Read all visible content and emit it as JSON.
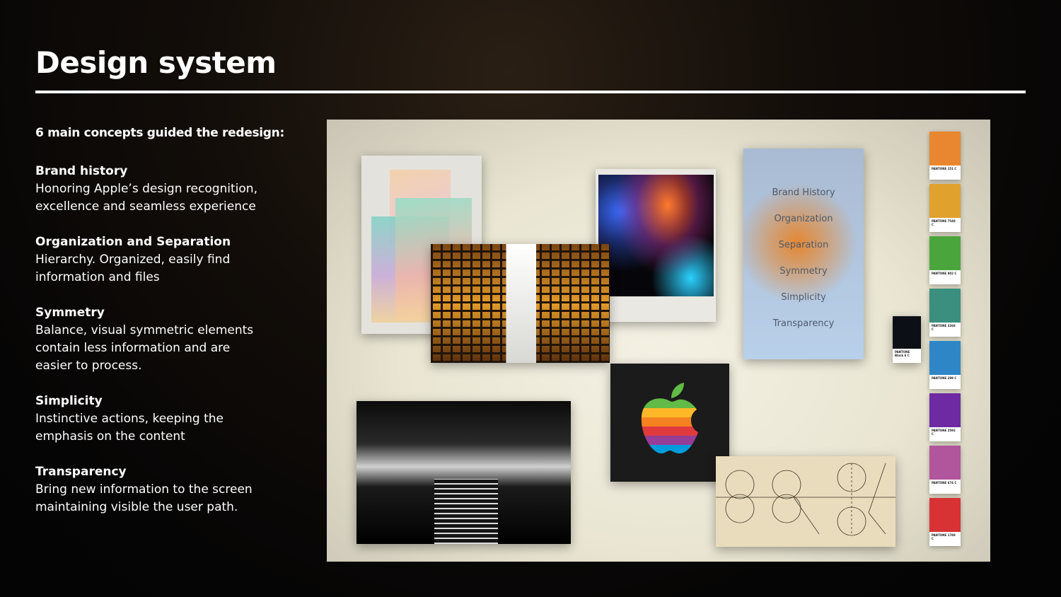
{
  "title": "Design system",
  "intro": "6 main concepts guided the redesign:",
  "concepts": [
    {
      "head": "Brand history",
      "body": "Honoring Apple’s design recognition, excellence and seamless experience"
    },
    {
      "head": "Organization and Separation",
      "body": "Hierarchy. Organized, easily find information and files"
    },
    {
      "head": "Symmetry",
      "body": "Balance, visual symmetric elements contain less information and are easier to process."
    },
    {
      "head": "Simplicity",
      "body": "Instinctive actions, keeping the emphasis on the content"
    },
    {
      "head": "Transparency",
      "body": "Bring new information to the screen maintaining visible the user path."
    }
  ],
  "moodboard": {
    "labels": [
      "Brand History",
      "Organization",
      "Separation",
      "Symmetry",
      "Simplicity",
      "Transparency"
    ],
    "swatches": [
      {
        "label": "PANTONE 151 C",
        "color": "#e8872f"
      },
      {
        "label": "PANTONE 7548 C",
        "color": "#e1a12d"
      },
      {
        "label": "PANTONE 802 C",
        "color": "#4aa63c"
      },
      {
        "label": "PANTONE 3268 C",
        "color": "#3a8f7e"
      },
      {
        "label": "PANTONE 299 C",
        "color": "#2f86c6"
      },
      {
        "label": "PANTONE 2592 C",
        "color": "#6d2aa2"
      },
      {
        "label": "PANTONE 674 C",
        "color": "#b1559c"
      },
      {
        "label": "PANTONE 1788 C",
        "color": "#d83235"
      }
    ],
    "black_swatch": {
      "label": "PANTONE Black 6 C",
      "color": "#0c1016"
    }
  }
}
